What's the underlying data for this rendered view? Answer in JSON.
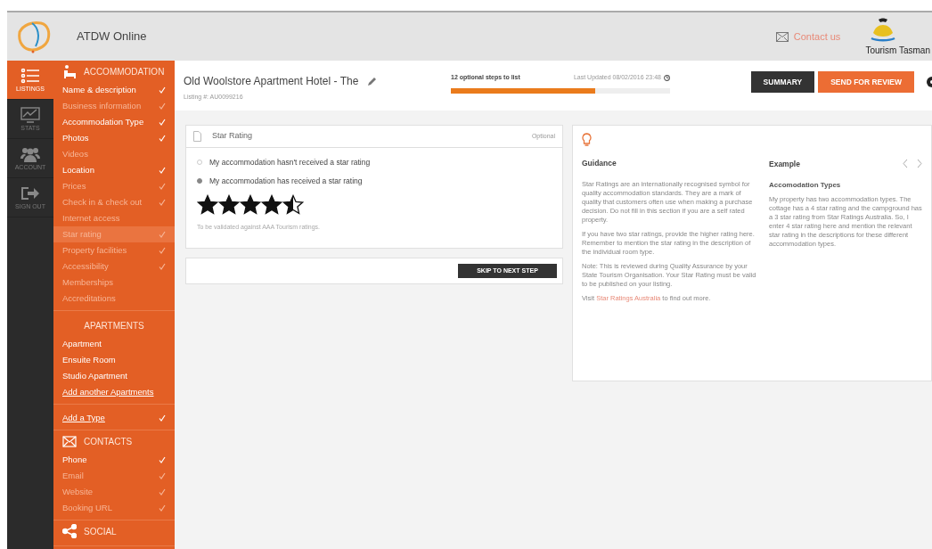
{
  "header": {
    "app_name": "ATDW Online",
    "contact": "Contact us",
    "partner": "Tourism Tasman"
  },
  "rail": [
    {
      "label": "LISTINGS",
      "kind": "list",
      "selected": true
    },
    {
      "label": "STATS",
      "kind": "stats",
      "selected": false
    },
    {
      "label": "ACCOUNT",
      "kind": "account",
      "selected": false
    },
    {
      "label": "SIGN OUT",
      "kind": "signout",
      "selected": false
    }
  ],
  "nav_sections": [
    {
      "title": "ACCOMMODATION",
      "kind": "accommodation",
      "items": [
        {
          "label": "Name & description",
          "muted": false,
          "checked": true,
          "selected": false,
          "kind": "item"
        },
        {
          "label": "Business information",
          "muted": true,
          "checked": true,
          "selected": false,
          "kind": "item"
        },
        {
          "label": "Accommodation Type",
          "muted": false,
          "checked": true,
          "selected": false,
          "kind": "item"
        },
        {
          "label": "Photos",
          "muted": false,
          "checked": true,
          "selected": false,
          "kind": "item"
        },
        {
          "label": "Videos",
          "muted": true,
          "checked": false,
          "selected": false,
          "kind": "item"
        },
        {
          "label": "Location",
          "muted": false,
          "checked": true,
          "selected": false,
          "kind": "item"
        },
        {
          "label": "Prices",
          "muted": true,
          "checked": true,
          "selected": false,
          "kind": "item"
        },
        {
          "label": "Check in & check out",
          "muted": true,
          "checked": true,
          "selected": false,
          "kind": "item"
        },
        {
          "label": "Internet access",
          "muted": true,
          "checked": false,
          "selected": false,
          "kind": "item"
        },
        {
          "label": "Star rating",
          "muted": true,
          "checked": true,
          "selected": true,
          "kind": "item"
        },
        {
          "label": "Property facilities",
          "muted": true,
          "checked": true,
          "selected": false,
          "kind": "item"
        },
        {
          "label": "Accessibility",
          "muted": true,
          "checked": true,
          "selected": false,
          "kind": "item"
        },
        {
          "label": "Memberships",
          "muted": true,
          "checked": false,
          "selected": false,
          "kind": "item"
        },
        {
          "label": "Accreditations",
          "muted": true,
          "checked": false,
          "selected": false,
          "kind": "item"
        }
      ]
    },
    {
      "title": "APARTMENTS",
      "kind": "plain",
      "items": [
        {
          "label": "Apartment",
          "muted": false,
          "checked": false,
          "selected": false,
          "kind": "item"
        },
        {
          "label": "Ensuite Room",
          "muted": false,
          "checked": false,
          "selected": false,
          "kind": "item"
        },
        {
          "label": "Studio Apartment",
          "muted": false,
          "checked": false,
          "selected": false,
          "kind": "item"
        },
        {
          "label": "Add another Apartments",
          "muted": false,
          "checked": false,
          "selected": false,
          "kind": "link"
        }
      ]
    },
    {
      "kind": "none",
      "items": [
        {
          "label": "Add a Type",
          "muted": false,
          "checked": true,
          "selected": false,
          "kind": "link"
        }
      ]
    },
    {
      "title": "CONTACTS",
      "kind": "contacts",
      "items": [
        {
          "label": "Phone",
          "muted": false,
          "checked": true,
          "selected": false,
          "kind": "item"
        },
        {
          "label": "Email",
          "muted": true,
          "checked": true,
          "selected": false,
          "kind": "item"
        },
        {
          "label": "Website",
          "muted": true,
          "checked": true,
          "selected": false,
          "kind": "item"
        },
        {
          "label": "Booking URL",
          "muted": true,
          "checked": true,
          "selected": false,
          "kind": "item"
        }
      ]
    },
    {
      "title": "SOCIAL",
      "kind": "social"
    }
  ],
  "listing": {
    "title": "Old Woolstore Apartment Hotel - The",
    "number": "Listing #: AU0099216",
    "steps": "12 optional steps to list",
    "level": 0.66,
    "updated": "Last Updated 08/02/2016 23:48",
    "buttons": [
      {
        "label": "SUMMARY",
        "kind": "dark"
      },
      {
        "label": "SEND FOR REVIEW",
        "kind": "accent"
      }
    ]
  },
  "star_card": {
    "title": "Star Rating",
    "tag": "Optional",
    "options": [
      {
        "label": "My accommodation hasn't received a star rating",
        "selected": false
      },
      {
        "label": "My accommodation has received a star rating",
        "selected": true
      }
    ],
    "stars": 4.5,
    "note": "To be validated against AAA Tourism ratings.",
    "skip": "SKIP TO NEXT STEP"
  },
  "guidance": {
    "title": "Guidance",
    "paragraphs": [
      {
        "text": "Star Ratings are an internationally recognised symbol for quality accommodation standards. They are a mark of quality that customers often use when making a purchase decision. Do not fill in this section if you are a self rated property."
      },
      {
        "text": "If you have two star ratings, provide the higher rating here. Remember to mention the star rating in the description of the individual room type."
      },
      {
        "text": "Note: This is reviewed during Quality Assurance by your State Tourism Organisation. Your Star Rating must be valid to be published on your listing."
      },
      {
        "text": "Visit ",
        "link": "Star Ratings Australia",
        "after": " to find out more."
      }
    ]
  },
  "example": {
    "title": "Example",
    "subtitle": "Accomodation Types",
    "text": "My property has two accommodation types. The cottage has a 4 star rating and the campground has a 3 star rating from Star Ratings Australia. So, I enter 4 star rating here and mention the relevant star rating in the descriptions for these different accommodation types."
  }
}
